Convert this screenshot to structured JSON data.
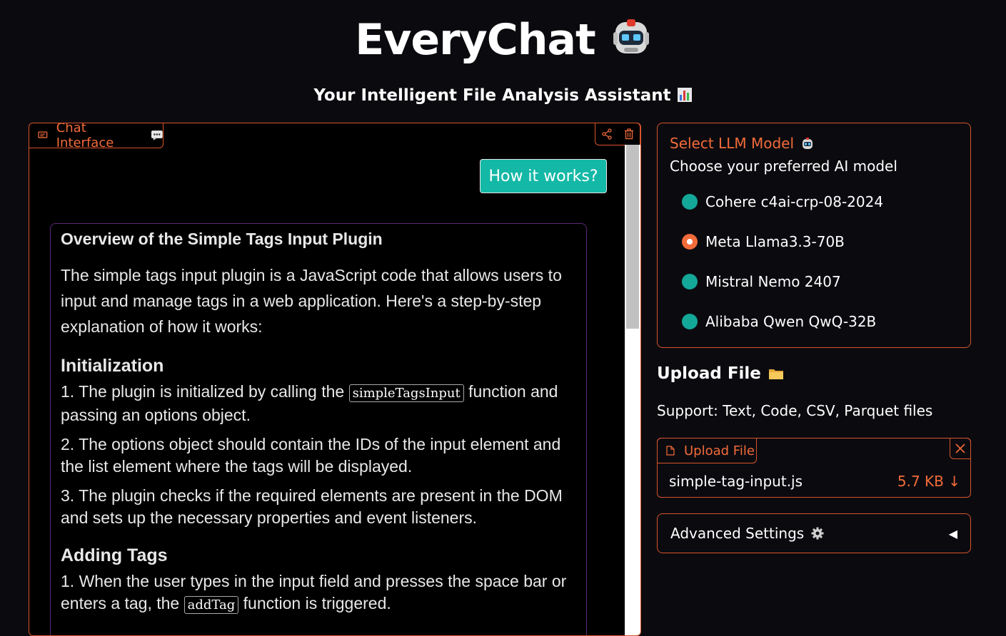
{
  "app": {
    "title": "EveryChat",
    "subtitle": "Your Intelligent File Analysis Assistant"
  },
  "chat": {
    "tab_label": "Chat Interface",
    "user_message": "How it works?",
    "bot": {
      "heading": "Overview of the Simple Tags Input Plugin",
      "intro": "The simple tags input plugin is a JavaScript code that allows users to input and manage tags in a web application. Here's a step-by-step explanation of how it works:",
      "sections": [
        {
          "title": "Initialization",
          "steps": [
            {
              "before": "1. The plugin is initialized by calling the ",
              "code": "simpleTagsInput",
              "after": " function and passing an options object."
            },
            {
              "before": "2. The options object should contain the IDs of the input element and the list element where the tags will be displayed.",
              "code": "",
              "after": ""
            },
            {
              "before": "3. The plugin checks if the required elements are present in the DOM and sets up the necessary properties and event listeners.",
              "code": "",
              "after": ""
            }
          ]
        },
        {
          "title": "Adding Tags",
          "steps": [
            {
              "before": "1. When the user types in the input field and presses the space bar or enters a tag, the ",
              "code": "addTag",
              "after": " function is triggered."
            }
          ]
        }
      ]
    }
  },
  "model_selector": {
    "title": "Select LLM Model",
    "subtitle": "Choose your preferred AI model",
    "options": [
      {
        "label": "Cohere c4ai-crp-08-2024",
        "selected": false
      },
      {
        "label": "Meta Llama3.3-70B",
        "selected": true
      },
      {
        "label": "Mistral Nemo 2407",
        "selected": false
      },
      {
        "label": "Alibaba Qwen QwQ-32B",
        "selected": false
      }
    ]
  },
  "upload": {
    "heading": "Upload File",
    "support_text": "Support: Text, Code, CSV, Parquet files",
    "tab_label": "Upload File",
    "file_name": "simple-tag-input.js",
    "file_size": "5.7 KB ↓"
  },
  "settings": {
    "label": "Advanced Settings",
    "caret": "◀"
  },
  "colors": {
    "accent": "#f26b3a",
    "border": "#d9532c",
    "teal": "#14b8a6",
    "background": "#0b0b0f"
  }
}
